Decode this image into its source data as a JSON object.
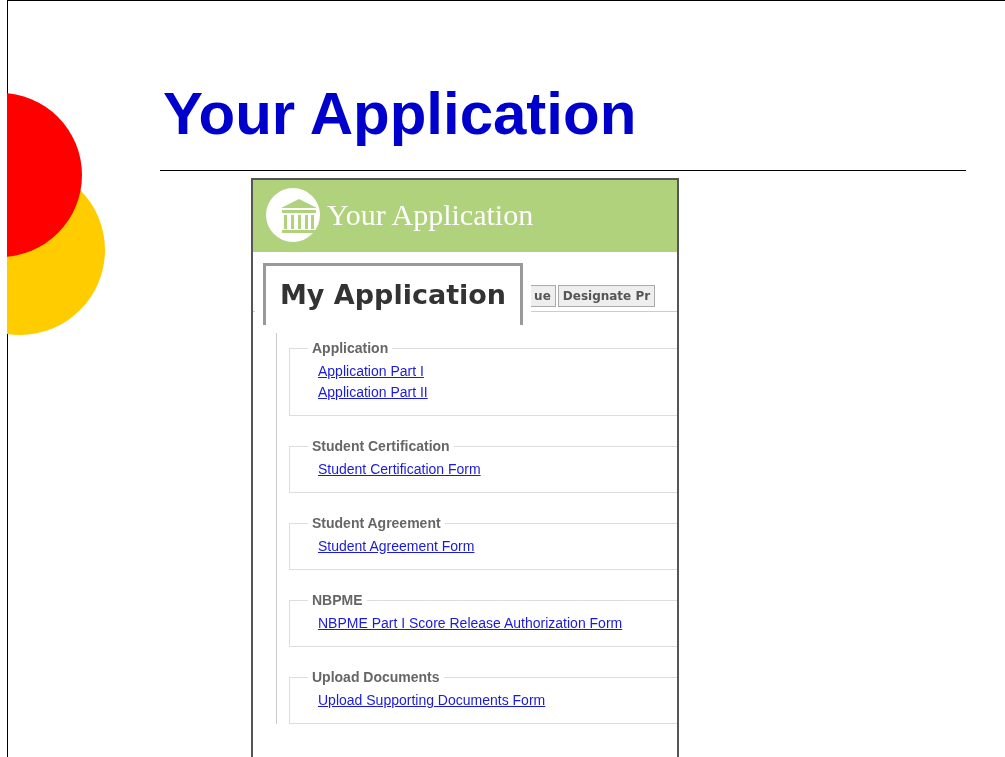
{
  "slide_title": "Your Application",
  "screenshot": {
    "header_title": "Your Application",
    "tabs": [
      {
        "label": "My Application",
        "selected": true
      },
      {
        "label": "ue",
        "selected": false
      },
      {
        "label": "Designate Pr",
        "selected": false
      }
    ],
    "sections": [
      {
        "legend": "Application",
        "links": [
          "Application Part I",
          "Application Part II"
        ]
      },
      {
        "legend": "Student Certification",
        "links": [
          "Student Certification Form"
        ]
      },
      {
        "legend": "Student Agreement",
        "links": [
          "Student Agreement Form"
        ]
      },
      {
        "legend": "NBPME",
        "links": [
          "NBPME Part I Score Release Authorization Form"
        ]
      },
      {
        "legend": "Upload Documents",
        "links": [
          "Upload Supporting Documents Form"
        ]
      }
    ]
  }
}
